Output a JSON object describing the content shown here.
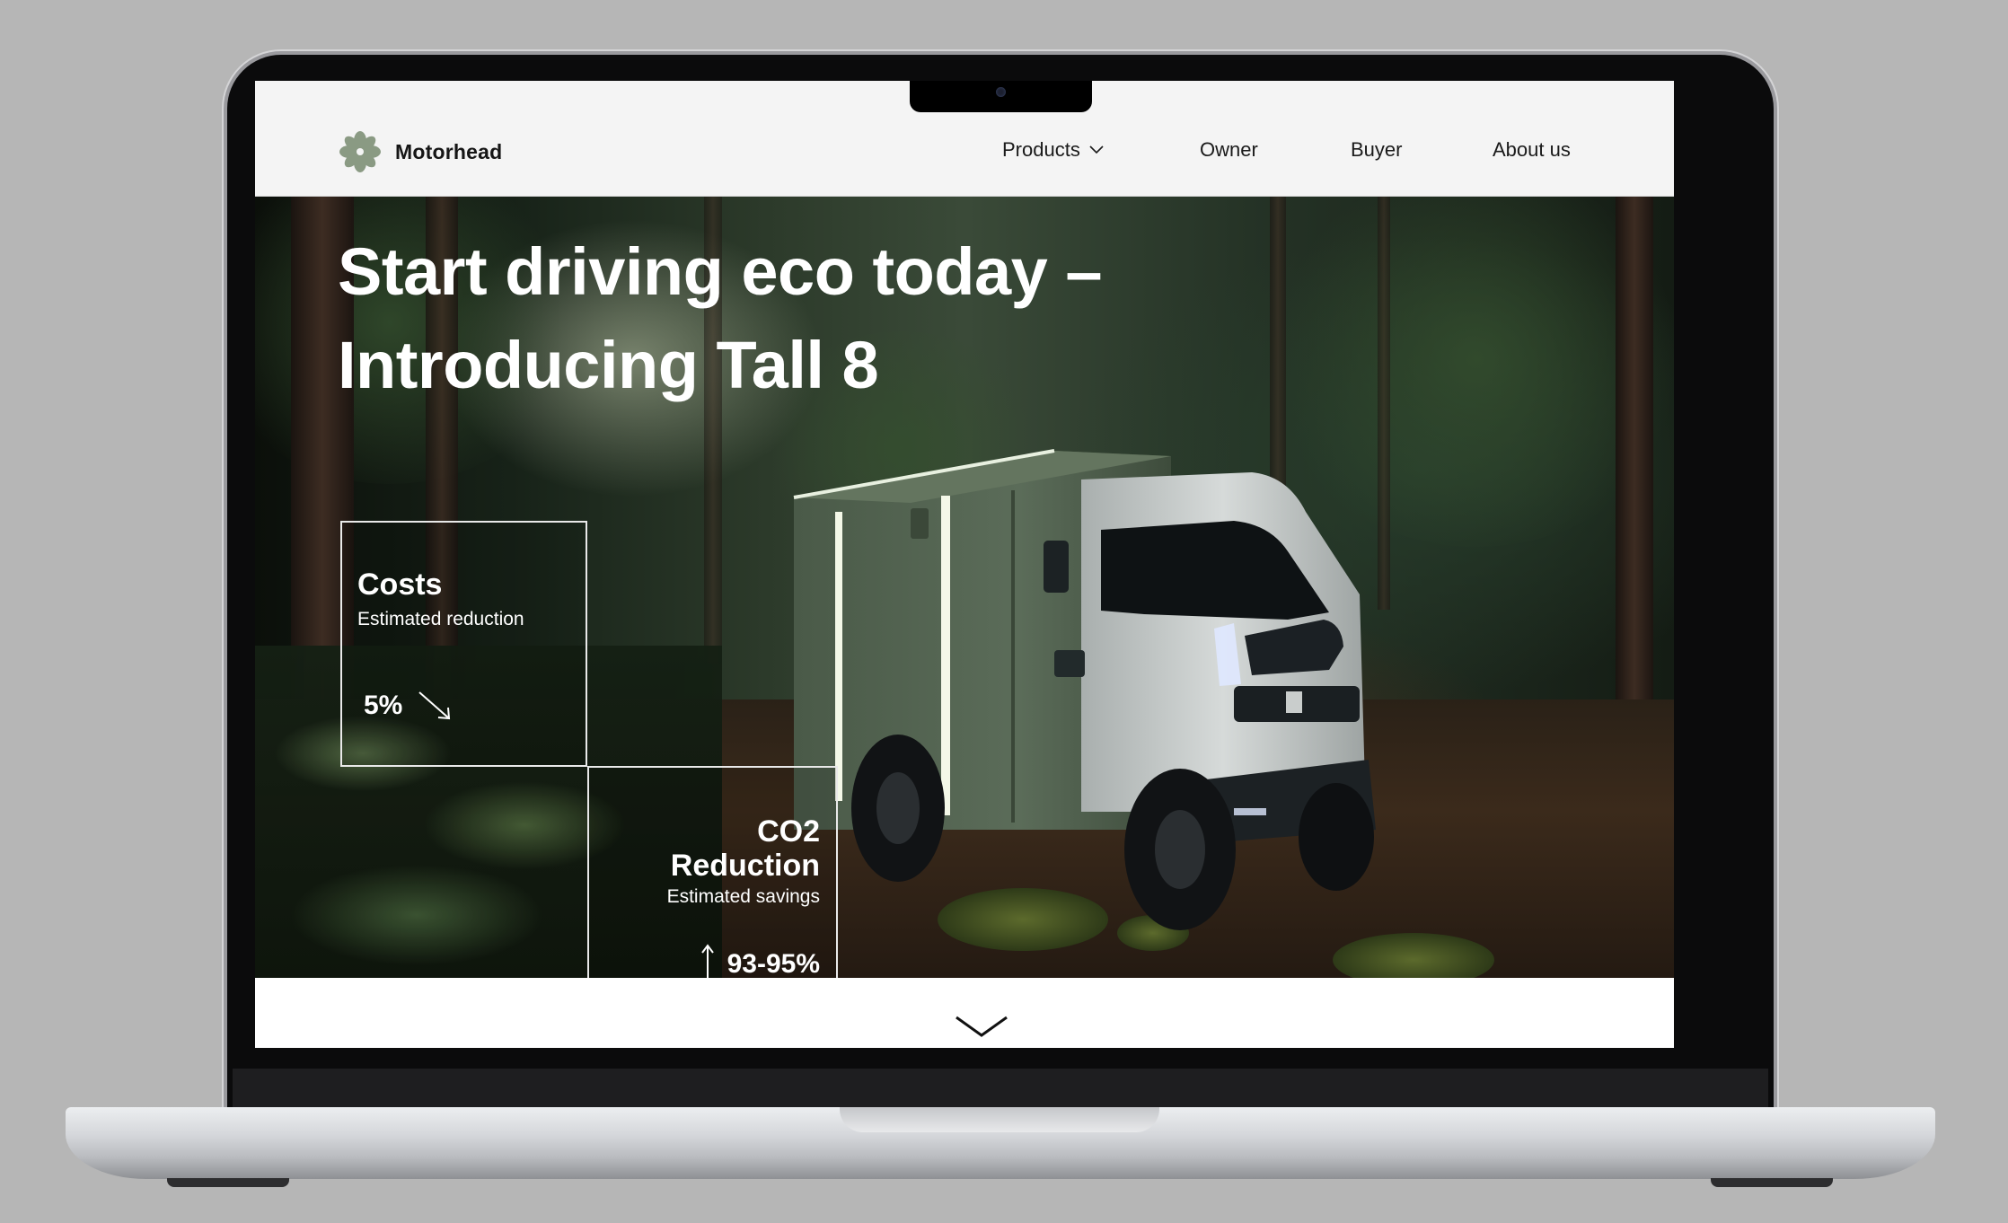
{
  "brand": {
    "name": "Motorhead",
    "logo_color": "#8a9a83"
  },
  "nav": {
    "items": [
      {
        "label": "Products",
        "has_dropdown": true
      },
      {
        "label": "Owner"
      },
      {
        "label": "Buyer"
      },
      {
        "label": "About us"
      }
    ]
  },
  "hero": {
    "title_line1": "Start driving eco today –",
    "title_line2": "Introducing Tall 8"
  },
  "stats": {
    "costs": {
      "title": "Costs",
      "subtitle": "Estimated reduction",
      "value": "5%",
      "trend_icon": "arrow-down-right-icon"
    },
    "co2": {
      "title": "CO2 Reduction",
      "subtitle": "Estimated savings",
      "value": "93-95%",
      "trend_icon": "arrow-up-icon"
    }
  },
  "scroll": {
    "icon": "chevron-down-icon"
  },
  "colors": {
    "nav_bg": "#f4f4f4",
    "accent": "#8a9a83",
    "truck_body": "#4e5e4c",
    "truck_cab": "#c9cdcc"
  }
}
